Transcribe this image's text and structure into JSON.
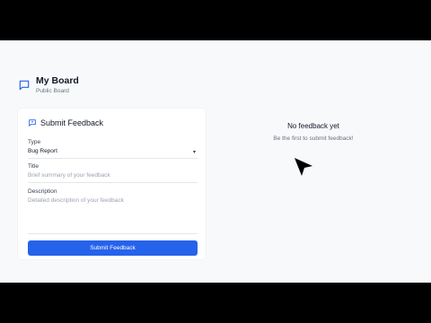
{
  "board": {
    "title": "My Board",
    "subtitle": "Public Board"
  },
  "form": {
    "title": "Submit Feedback",
    "type_label": "Type",
    "type_value": "Bug Report",
    "title_label": "Title",
    "title_placeholder": "Brief summary of your feedback",
    "description_label": "Description",
    "description_placeholder": "Detailed description of your feedback",
    "submit_label": "Submit Feedback"
  },
  "empty_state": {
    "title": "No feedback yet",
    "subtitle": "Be the first to submit feedback!"
  },
  "colors": {
    "accent": "#2563eb",
    "background": "#f8f9fb"
  },
  "icons": {
    "board": "chat-bubble-icon",
    "form": "message-square-icon",
    "dropdown": "chevron-down-icon"
  }
}
